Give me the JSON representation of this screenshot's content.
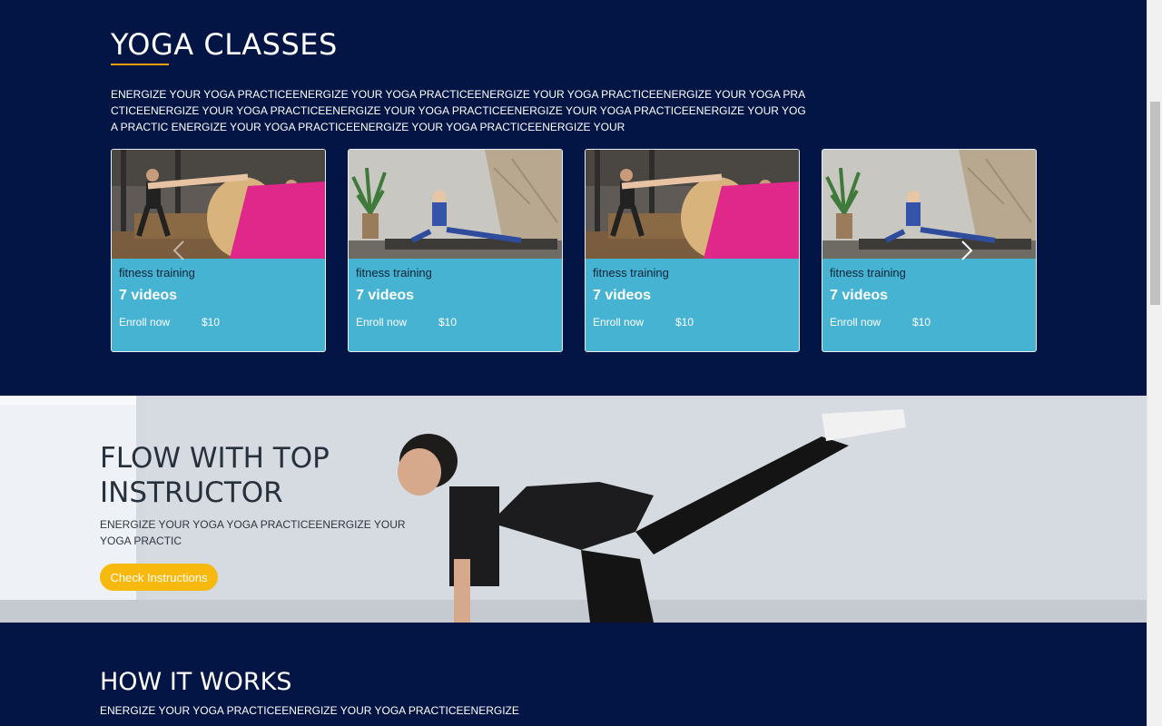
{
  "yoga_classes": {
    "title": "YOGA CLASSES",
    "description": "ENERGIZE YOUR YOGA PRACTICEENERGIZE YOUR YOGA PRACTICEENERGIZE YOUR YOGA PRACTICEENERGIZE YOUR YOGA PRACTICEENERGIZE YOUR YOGA PRACTICEENERGIZE YOUR YOGA PRACTICEENERGIZE YOUR YOGA PRACTICEENERGIZE YOUR YOGA PRACTIC ENERGIZE YOUR YOGA PRACTICEENERGIZE YOUR YOGA PRACTICEENERGIZE YOUR",
    "cards": [
      {
        "category": "fitness training",
        "count": "7 videos",
        "enroll": "Enroll now",
        "price": "$10",
        "image": "group-stretch-photo"
      },
      {
        "category": "fitness training",
        "count": "7 videos",
        "enroll": "Enroll now",
        "price": "$10",
        "image": "seated-twist-photo"
      },
      {
        "category": "fitness training",
        "count": "7 videos",
        "enroll": "Enroll now",
        "price": "$10",
        "image": "group-stretch-photo"
      },
      {
        "category": "fitness training",
        "count": "7 videos",
        "enroll": "Enroll now",
        "price": "$10",
        "image": "seated-twist-photo"
      }
    ],
    "prev_icon": "chevron-left-icon",
    "next_icon": "chevron-right-icon"
  },
  "hero": {
    "title": "FLOW WITH TOP INSTRUCTOR",
    "description": "ENERGIZE YOUR YOGA YOGA PRACTICEENERGIZE YOUR YOGA PRACTIC",
    "button_label": "Check Instructions"
  },
  "how_it_works": {
    "title": "HOW IT WORKS",
    "description": "ENERGIZE YOUR YOGA PRACTICEENERGIZE YOUR YOGA PRACTICEENERGIZE"
  },
  "colors": {
    "background": "#031544",
    "card": "#46b3d3",
    "accent": "#f7b90d",
    "underline": "#f2a007"
  }
}
